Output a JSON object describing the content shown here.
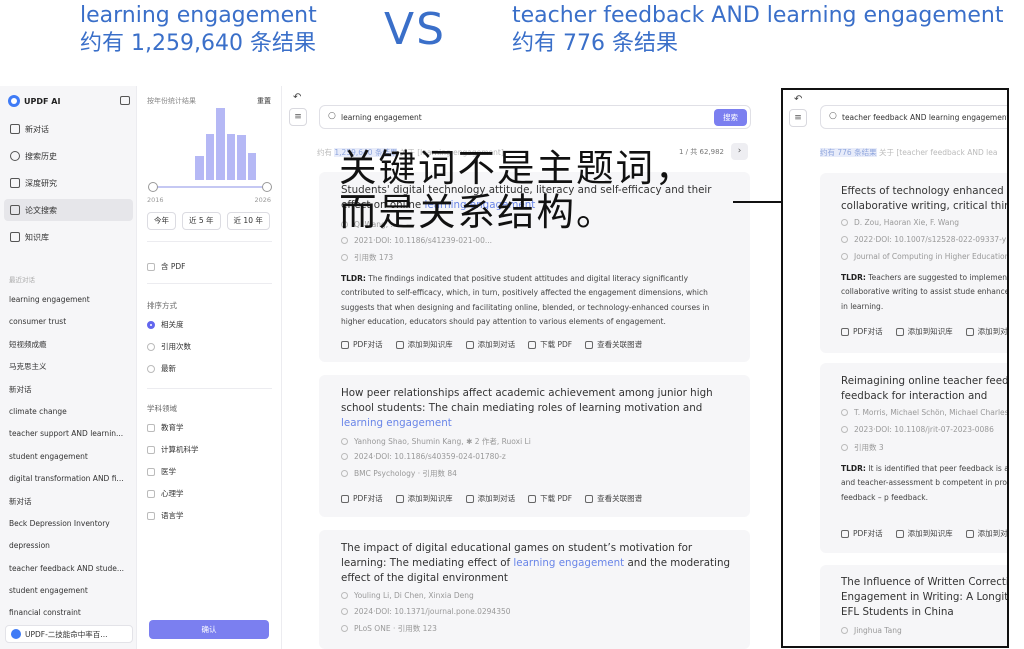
{
  "comparison": {
    "left_query": "learning engagement",
    "left_count": "约有 1,259,640 条结果",
    "vs": "VS",
    "right_query": "teacher feedback AND learning engagement",
    "right_count": "约有 776 条结果"
  },
  "annotation": {
    "line1": "关键词不是主题词，",
    "line2": "而是关系结构。"
  },
  "sidebar": {
    "app_title": "UPDF AI",
    "nav": [
      {
        "label": "新对话",
        "icon": "new-chat-icon"
      },
      {
        "label": "搜索历史",
        "icon": "search-icon"
      },
      {
        "label": "深度研究",
        "icon": "research-icon"
      },
      {
        "label": "论文搜索",
        "icon": "paper-icon",
        "active": true
      },
      {
        "label": "知识库",
        "icon": "library-icon"
      }
    ],
    "recent_label": "最近对话",
    "recent": [
      "learning engagement",
      "consumer trust",
      "短视频成瘾",
      "马克思主义",
      "新对话",
      "climate change",
      "teacher support AND learnin...",
      "student engagement",
      "digital transformation AND fi...",
      "新对话",
      "Beck Depression Inventory",
      "depression",
      "teacher feedback AND stude...",
      "student engagement",
      "financial constraint"
    ],
    "footer": "UPDF-二技能命中率百..."
  },
  "filter": {
    "title": "按年份统计结果",
    "reset": "重置",
    "year_start": "2016",
    "year_end": "2026",
    "histogram": [
      0.0,
      0.0,
      0.0,
      0.0,
      0.33,
      0.64,
      1.0,
      0.64,
      0.62,
      0.38,
      0.0
    ],
    "year_buttons": [
      "今年",
      "近 5 年",
      "近 10 年"
    ],
    "pdf_label": "含 PDF",
    "sort_label": "排序方式",
    "sort_options": [
      "相关度",
      "引用次数",
      "最新"
    ],
    "sort_selected": "相关度",
    "field_label": "学科领域",
    "fields": [
      "教育学",
      "计算机科学",
      "医学",
      "心理学",
      "语言学"
    ],
    "confirm": "确认"
  },
  "main": {
    "query": "learning engagement",
    "search_button": "搜索",
    "meta_prefix": "约有",
    "meta_highlight": "1,259,640 条结果",
    "meta_suffix": "关于 [learning engagement]",
    "page_indicator": "1 / 共 62,982",
    "cards": [
      {
        "title_pre": "Students' digital technology attitude, literacy and self-efficacy and their effect on online ",
        "title_kw": "learning engagement",
        "title_post": "",
        "authors": "Q. Wang, ...",
        "doi": "2021·DOI: 10.1186/s41239-021-00...",
        "source": "引用数 173",
        "tldr_label": "TLDR:",
        "tldr": "The findings indicated that positive student attitudes and digital literacy significantly contributed to self-efficacy, which, in turn, positively affected the engagement dimensions, which suggests that when designing and facilitating online, blended, or technology-enhanced courses in higher education, educators should pay attention to various elements of engagement.",
        "actions": [
          "PDF对话",
          "添加到知识库",
          "添加到对话",
          "下载 PDF",
          "查看关联图谱"
        ]
      },
      {
        "title_pre": "How peer relationships affect academic achievement among junior high school students: The chain mediating roles of learning motivation and ",
        "title_kw": "learning engagement",
        "title_post": "",
        "authors": "Yanhong Shao, Shumin Kang, ✱ 2 作者, Ruoxi Li",
        "doi": "2024·DOI: 10.1186/s40359-024-01780-z",
        "source": "BMC Psychology · 引用数 84",
        "actions": [
          "PDF对话",
          "添加到知识库",
          "添加到对话",
          "下载 PDF",
          "查看关联图谱"
        ]
      },
      {
        "title_pre": "The impact of digital educational games on student’s motivation for learning: The mediating effect of ",
        "title_kw": "learning engagement",
        "title_post": " and the moderating effect of the digital environment",
        "authors": "Youling Li, Di Chen, Xinxia Deng",
        "doi": "2024·DOI: 10.1371/journal.pone.0294350",
        "source": "PLoS ONE · 引用数 123"
      }
    ]
  },
  "right_panel": {
    "query": "teacher feedback AND learning engagement",
    "meta_highlight": "约有 776 条结果",
    "meta_suffix": "关于 [teacher feedback AND lea",
    "cards": [
      {
        "title": "Effects of technology enhanced peer, collaborative writing, critical thinking",
        "authors": "D. Zou, Haoran Xie, F. Wang",
        "doi": "2022·DOI: 10.1007/s12528-022-09337-y",
        "source": "Journal of Computing in Higher Education",
        "tldr_label": "TLDR:",
        "tldr": "Teachers are suggested to implement assisted collaborative writing to assist stude enhance their engagement in learning.",
        "actions": [
          "PDF对话",
          "添加到知识库",
          "添加到对话"
        ]
      },
      {
        "title": "Reimagining online teacher feedback peer feedback for interaction and",
        "authors": "T. Morris, Michael Schön, Michael Charles",
        "doi": "2023·DOI: 10.1108/jrit-07-2023-0086",
        "source": "引用数 3",
        "tldr_label": "TLDR:",
        "tldr": "It is identified that peer feedback is a supplement self- and teacher-assessment b competent in providing (peer) feedback – p feedback.",
        "actions": [
          "PDF对话",
          "添加到知识库",
          "添加到对话"
        ]
      },
      {
        "title": "The Influence of Written Corrective Engagement in Writing: A Longitudinal School EFL Students in China",
        "authors": "Jinghua Tang"
      }
    ]
  },
  "colors": {
    "accent": "#7b7ff0",
    "header_blue": "#3a6fc9",
    "keyword": "#6a86e8"
  }
}
